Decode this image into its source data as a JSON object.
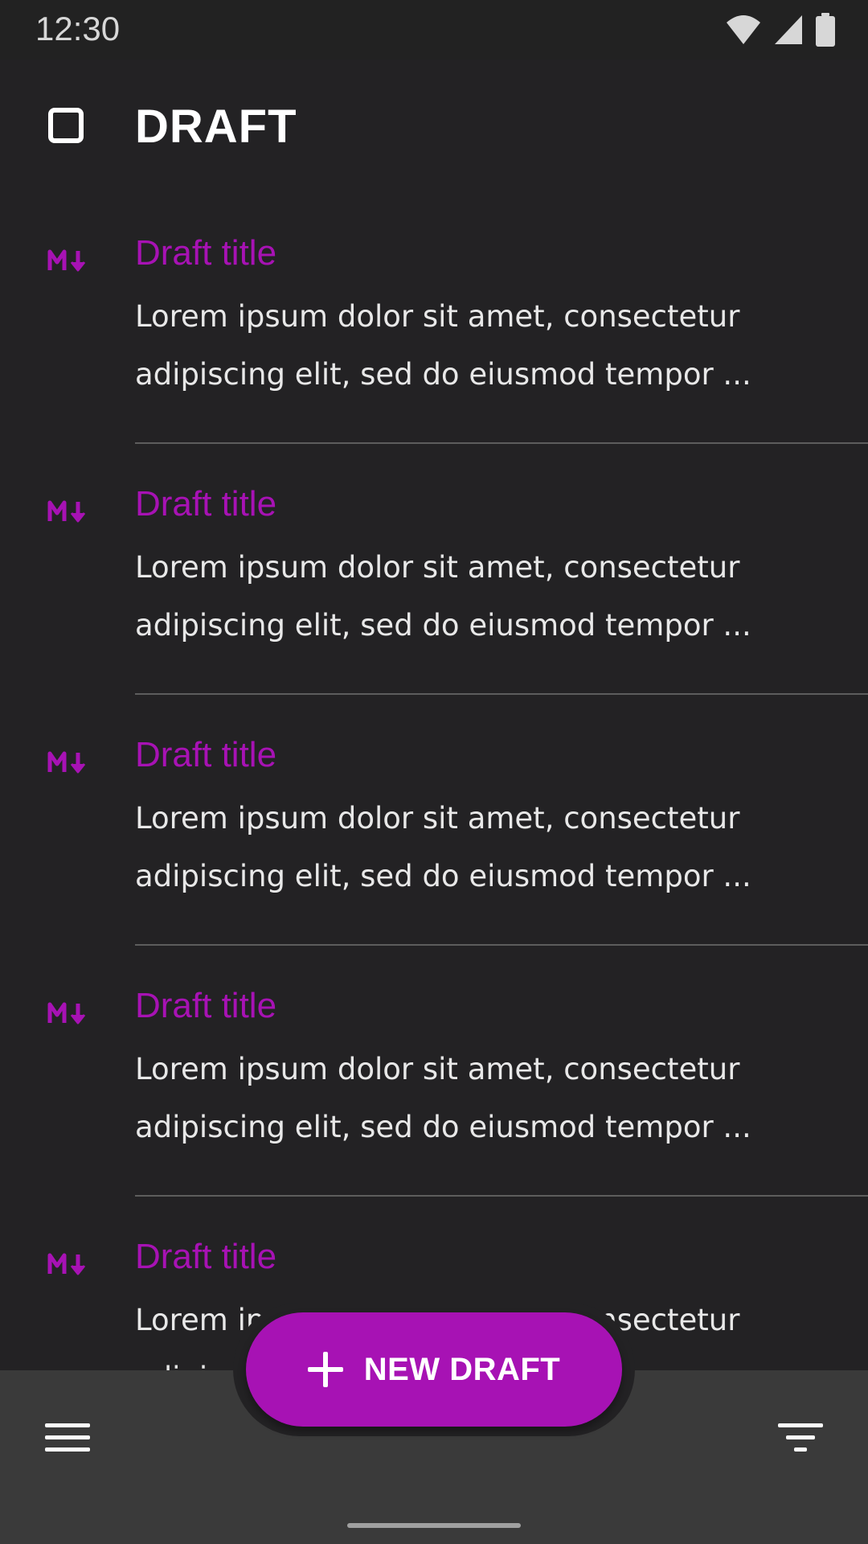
{
  "status_bar": {
    "time": "12:30"
  },
  "header": {
    "title": "DRAFT"
  },
  "drafts": [
    {
      "title": "Draft title",
      "line1": "Lorem ipsum dolor sit amet, consectetur",
      "line2": "adipiscing elit, sed do eiusmod tempor ..."
    },
    {
      "title": "Draft title",
      "line1": "Lorem ipsum dolor sit amet, consectetur",
      "line2": "adipiscing elit, sed do eiusmod tempor ..."
    },
    {
      "title": "Draft title",
      "line1": "Lorem ipsum dolor sit amet, consectetur",
      "line2": "adipiscing elit, sed do eiusmod tempor ..."
    },
    {
      "title": "Draft title",
      "line1": "Lorem ipsum dolor sit amet, consectetur",
      "line2": "adipiscing elit, sed do eiusmod tempor ..."
    },
    {
      "title": "Draft title",
      "line1": "Lorem ipsum dolor sit amet, consectetur",
      "line2": "adipiscing elit, sed do eiusmod tempor ..."
    }
  ],
  "fab": {
    "label": "NEW DRAFT",
    "icon": "plus-icon"
  },
  "bottom_bar": {
    "left_icon": "menu-icon",
    "right_icon": "filter-icon"
  },
  "colors": {
    "accent": "#a712b4",
    "background": "#232224",
    "bottom_bar": "#3a3a3a",
    "text": "#e8e8e8"
  }
}
